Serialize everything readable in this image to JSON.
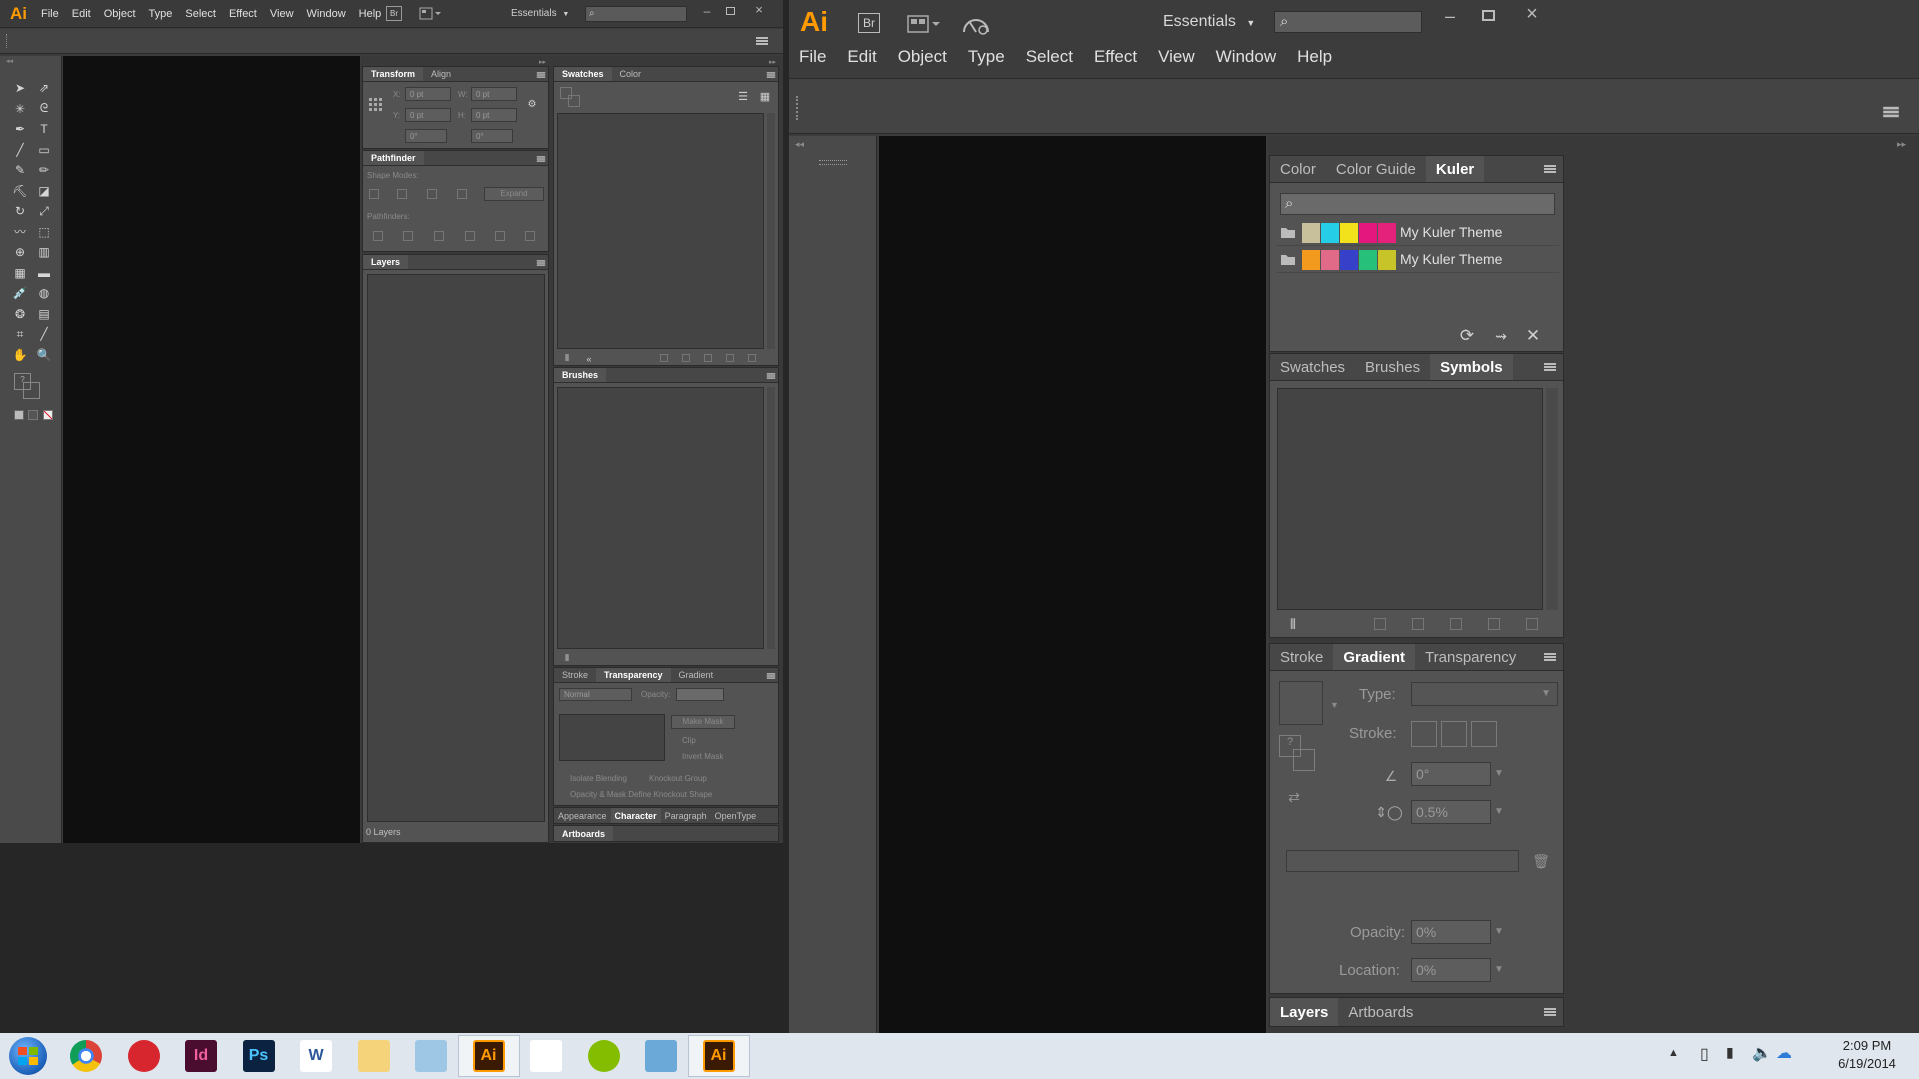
{
  "left_window": {
    "logo": "Ai",
    "menu": [
      "File",
      "Edit",
      "Object",
      "Type",
      "Select",
      "Effect",
      "View",
      "Window",
      "Help"
    ],
    "bridge": "Br",
    "workspace": "Essentials",
    "transform_panel": {
      "tabs": [
        "Transform",
        "Align"
      ],
      "x": "0 pt",
      "y": "0 pt",
      "w": "0 pt",
      "h": "0 pt",
      "angle": "0°",
      "shear": "0°",
      "x_label": "X:",
      "y_label": "Y:",
      "w_label": "W:",
      "h_label": "H:"
    },
    "pathfinder_panel": {
      "title": "Pathfinder",
      "shape_modes": "Shape Modes:",
      "pathfinders": "Pathfinders:",
      "expand": "Expand"
    },
    "layers_panel": {
      "title": "Layers",
      "footer": "0 Layers"
    },
    "swatches_panel": {
      "tabs": [
        "Swatches",
        "Color"
      ]
    },
    "brushes_panel": {
      "title": "Brushes"
    },
    "transparency_panel": {
      "tabs": [
        "Stroke",
        "Transparency",
        "Gradient"
      ],
      "blend": "Normal",
      "opacity_label": "Opacity:",
      "make_mask": "Make Mask",
      "clip": "Clip",
      "invert": "Invert Mask",
      "isolate": "Isolate Blending",
      "knockout": "Knockout Group",
      "define": "Opacity & Mask Define Knockout Shape"
    },
    "character_tabs": [
      "Appearance",
      "Character",
      "Paragraph",
      "OpenType"
    ],
    "artboards": "Artboards"
  },
  "right_window": {
    "logo": "Ai",
    "menu": [
      "File",
      "Edit",
      "Object",
      "Type",
      "Select",
      "Effect",
      "View",
      "Window",
      "Help"
    ],
    "bridge": "Br",
    "workspace": "Essentials",
    "color_tabs": [
      "Color",
      "Color Guide",
      "Kuler"
    ],
    "kuler_themes": [
      {
        "name": "My Kuler Theme",
        "colors": [
          "#c8c09a",
          "#25cde6",
          "#f1e21c",
          "#e3177e",
          "#e4227c"
        ]
      },
      {
        "name": "My Kuler Theme",
        "colors": [
          "#f29a1e",
          "#e06a88",
          "#3740c8",
          "#27c07a",
          "#c7c42a"
        ]
      }
    ],
    "symbols_tabs": [
      "Swatches",
      "Brushes",
      "Symbols"
    ],
    "gradient_tabs": [
      "Stroke",
      "Gradient",
      "Transparency"
    ],
    "gradient": {
      "type_label": "Type:",
      "stroke_label": "Stroke:",
      "angle": "0°",
      "aspect": "0.5%",
      "opacity_label": "Opacity:",
      "opacity": "0%",
      "location_label": "Location:",
      "location": "0%"
    },
    "bottom_tabs": [
      "Layers",
      "Artboards"
    ]
  },
  "taskbar": {
    "time": "2:09 PM",
    "date": "6/19/2014",
    "apps": [
      {
        "name": "chrome",
        "label": ""
      },
      {
        "name": "creative-cloud",
        "label": ""
      },
      {
        "name": "indesign",
        "label": "Id"
      },
      {
        "name": "photoshop",
        "label": "Ps"
      },
      {
        "name": "word",
        "label": "W"
      },
      {
        "name": "explorer",
        "label": ""
      },
      {
        "name": "notepad",
        "label": ""
      },
      {
        "name": "illustrator",
        "label": "Ai"
      },
      {
        "name": "apps",
        "label": ""
      },
      {
        "name": "spotify",
        "label": ""
      },
      {
        "name": "remote",
        "label": ""
      },
      {
        "name": "illustrator-2",
        "label": "Ai"
      }
    ]
  }
}
